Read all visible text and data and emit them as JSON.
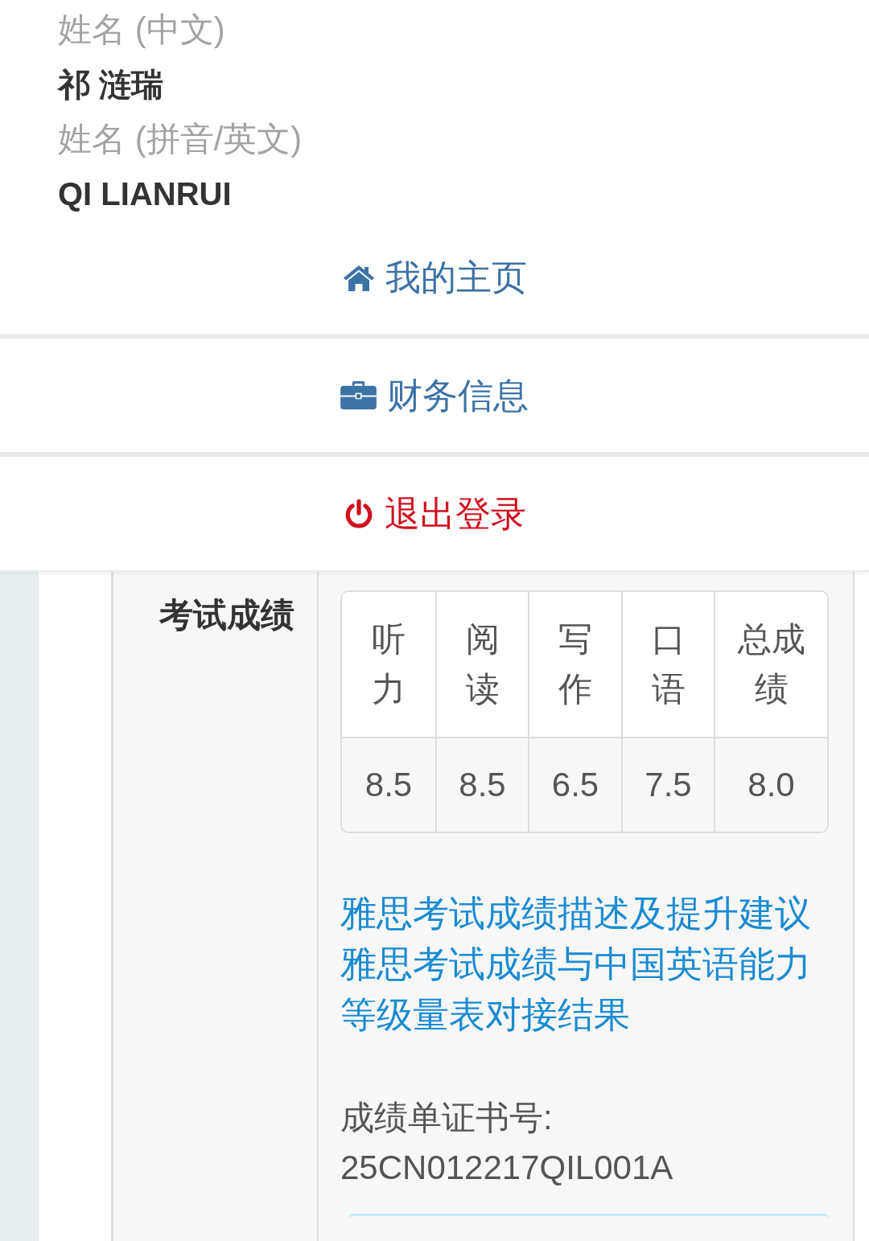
{
  "profile": [
    {
      "label": "姓名 (中文)",
      "value": "祁 涟瑞"
    },
    {
      "label": "姓名 (拼音/英文)",
      "value": "QI LIANRUI"
    }
  ],
  "menu": [
    {
      "kind": "home",
      "label": "我的主页"
    },
    {
      "kind": "finance",
      "label": "财务信息"
    },
    {
      "kind": "logout",
      "label": "退出登录"
    }
  ],
  "section": {
    "title": "考试成绩",
    "scores": {
      "columns": [
        "听力",
        "阅读",
        "写作",
        "口语",
        "总成绩"
      ],
      "rows": [
        [
          "8.5",
          "8.5",
          "6.5",
          "7.5",
          "8.0"
        ]
      ]
    },
    "links": [
      "雅思考试成绩描述及提升建议",
      "雅思考试成绩与中国英语能力等级量表对接结果"
    ],
    "certificate": {
      "label": "成绩单证书号:",
      "value": "25CN012217QIL001A"
    }
  }
}
